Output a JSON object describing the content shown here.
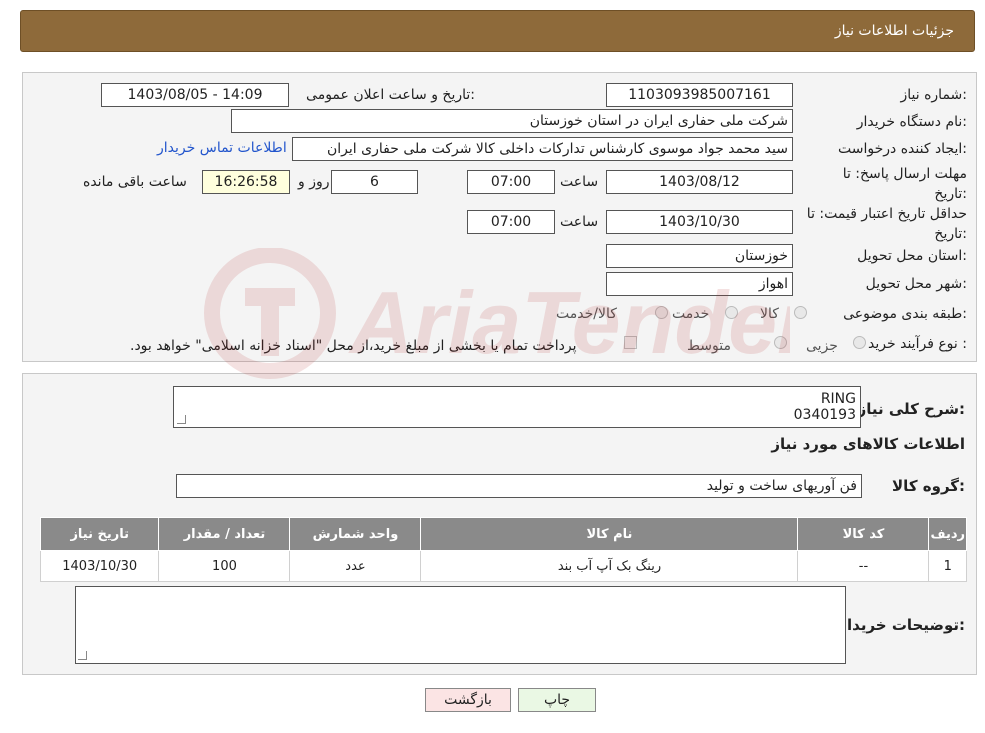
{
  "header": {
    "title": "جزئیات اطلاعات نیاز"
  },
  "need_number": {
    "label": "شماره نیاز:",
    "value": "1103093985007161"
  },
  "announce_datetime": {
    "label": "تاریخ و ساعت اعلان عمومی:",
    "value": "1403/08/05 - 14:09"
  },
  "buyer_org": {
    "label": "نام دستگاه خریدار:",
    "value": "شرکت ملی حفاری ایران در استان خوزستان"
  },
  "requester": {
    "label": "ایجاد کننده درخواست:",
    "value": "سید محمد جواد موسوی کارشناس تدارکات داخلی کالا شرکت ملی حفاری ایران",
    "contact_link": "اطلاعات تماس خریدار"
  },
  "reply_deadline": {
    "label": "مهلت ارسال پاسخ: تا تاریخ:",
    "date": "1403/08/12",
    "time_label": "ساعت",
    "time": "07:00",
    "days": "6",
    "days_label": "روز و",
    "remaining": "16:26:58",
    "remaining_label": "ساعت باقی مانده"
  },
  "price_validity": {
    "label": "حداقل تاریخ اعتبار قیمت: تا تاریخ:",
    "date": "1403/10/30",
    "time_label": "ساعت",
    "time": "07:00"
  },
  "delivery_province": {
    "label": "استان محل تحویل:",
    "value": "خوزستان"
  },
  "delivery_city": {
    "label": "شهر محل تحویل:",
    "value": "اهواز"
  },
  "category": {
    "label": "طبقه بندی موضوعی:",
    "options": [
      "کالا",
      "خدمت",
      "کالا/خدمت"
    ]
  },
  "purchase_type": {
    "label": "نوع فرآیند خرید :",
    "options": [
      "جزیی",
      "متوسط"
    ],
    "note": "پرداخت تمام یا بخشی از مبلغ خرید،از محل \"اسناد خزانه اسلامی\" خواهد بود."
  },
  "description": {
    "label": "شرح کلی نیاز:",
    "line1": "RING",
    "line2": "0340193"
  },
  "items_section": {
    "title": "اطلاعات کالاهای مورد نیاز"
  },
  "goods_group": {
    "label": "گروه کالا:",
    "value": "فن آوریهای ساخت و تولید"
  },
  "table": {
    "headers": [
      "ردیف",
      "کد کالا",
      "نام کالا",
      "واحد شمارش",
      "تعداد / مقدار",
      "تاریخ نیاز"
    ],
    "rows": [
      {
        "index": "1",
        "code": "--",
        "name": "رینگ بک آپ آب بند",
        "unit": "عدد",
        "qty": "100",
        "date": "1403/10/30"
      }
    ]
  },
  "buyer_notes": {
    "label": "توضیحات خریدار:",
    "value": ""
  },
  "buttons": {
    "print": "چاپ",
    "back": "بازگشت"
  },
  "watermark": {
    "text": "AriaTender.neT"
  },
  "colors": {
    "header_bg": "#8e6a3a",
    "table_header": "#8a8a8a",
    "print_btn": "#eaf8e4",
    "back_btn": "#fbe4e4",
    "link": "#2255cc"
  }
}
